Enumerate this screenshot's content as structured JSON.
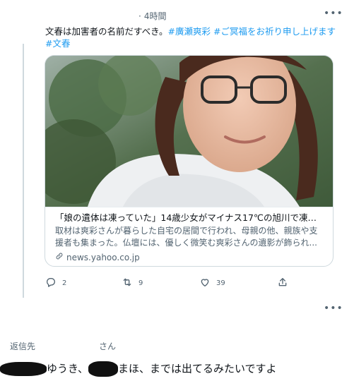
{
  "tweet": {
    "time_label": "4時間",
    "text_plain": "文春は加害者の名前だすべき。",
    "hashtags": [
      "#廣瀬爽彩",
      "#ご冥福をお祈り申し上げます",
      "#文春"
    ]
  },
  "card": {
    "title": "「娘の遺体は凍っていた」14歳少女がマイナス17℃の旭川で凍死　背...",
    "description": "取材は爽彩さんが暮らした自宅の居間で行われ、母親の他、親族や支援者も集まった。仏壇には、優しく微笑む爽彩さんの遺影が飾られ...",
    "domain": "news.yahoo.co.jp"
  },
  "actions": {
    "reply_count": "2",
    "retweet_count": "9",
    "like_count": "39"
  },
  "reply": {
    "reply_to_label": "返信先",
    "san_label": "さん",
    "text_part1": "ゆうき、",
    "text_part2": "まほ、までは出てるみたいですよ"
  },
  "icons": {
    "more": "more-horizontal-icon",
    "reply": "comment-icon",
    "retweet": "retweet-icon",
    "like": "heart-icon",
    "share": "share-icon",
    "link": "link-icon"
  },
  "colors": {
    "hashtag": "#1d9bf0",
    "secondary_text": "#536471",
    "border": "#cfd9de"
  }
}
